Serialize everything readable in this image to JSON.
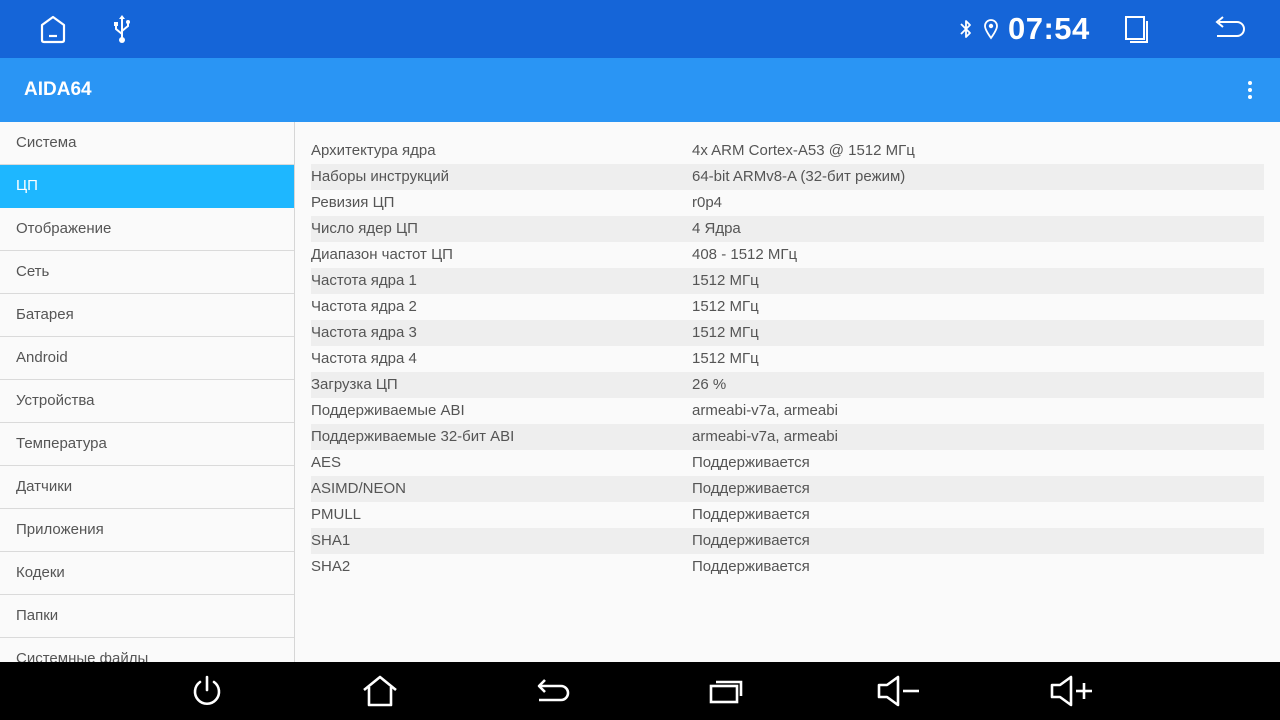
{
  "status_bar": {
    "time": "07:54",
    "icons": [
      "home-icon",
      "usb-icon",
      "bluetooth-icon",
      "location-icon",
      "window-icon",
      "back-icon"
    ]
  },
  "app_bar": {
    "title": "AIDA64",
    "menu_icon": "more-vert-icon"
  },
  "sidebar": {
    "items": [
      {
        "label": "Система",
        "active": false
      },
      {
        "label": "ЦП",
        "active": true
      },
      {
        "label": "Отображение",
        "active": false
      },
      {
        "label": "Сеть",
        "active": false
      },
      {
        "label": "Батарея",
        "active": false
      },
      {
        "label": "Android",
        "active": false
      },
      {
        "label": "Устройства",
        "active": false
      },
      {
        "label": "Температура",
        "active": false
      },
      {
        "label": "Датчики",
        "active": false
      },
      {
        "label": "Приложения",
        "active": false
      },
      {
        "label": "Кодеки",
        "active": false
      },
      {
        "label": "Папки",
        "active": false
      },
      {
        "label": "Системные файлы",
        "active": false
      }
    ]
  },
  "details": {
    "rows": [
      {
        "key": "Архитектура ядра",
        "value": "4x ARM Cortex-A53 @ 1512 МГц"
      },
      {
        "key": "Наборы инструкций",
        "value": "64-bit ARMv8-A (32-бит режим)"
      },
      {
        "key": "Ревизия ЦП",
        "value": "r0p4"
      },
      {
        "key": "Число ядер ЦП",
        "value": "4 Ядра"
      },
      {
        "key": "Диапазон частот ЦП",
        "value": "408 - 1512 МГц"
      },
      {
        "key": "Частота ядра 1",
        "value": "1512 МГц"
      },
      {
        "key": "Частота ядра 2",
        "value": "1512 МГц"
      },
      {
        "key": "Частота ядра 3",
        "value": "1512 МГц"
      },
      {
        "key": "Частота ядра 4",
        "value": "1512 МГц"
      },
      {
        "key": "Загрузка ЦП",
        "value": "26 %"
      },
      {
        "key": "Поддерживаемые ABI",
        "value": "armeabi-v7a, armeabi"
      },
      {
        "key": "Поддерживаемые 32-бит ABI",
        "value": "armeabi-v7a, armeabi"
      },
      {
        "key": "AES",
        "value": "Поддерживается"
      },
      {
        "key": "ASIMD/NEON",
        "value": "Поддерживается"
      },
      {
        "key": "PMULL",
        "value": "Поддерживается"
      },
      {
        "key": "SHA1",
        "value": "Поддерживается"
      },
      {
        "key": "SHA2",
        "value": "Поддерживается"
      }
    ]
  },
  "nav_bar": {
    "buttons": [
      "power-icon",
      "home-icon",
      "back-icon",
      "recents-icon",
      "volume-down-icon",
      "volume-up-icon"
    ]
  },
  "colors": {
    "status_bar": "#1565d8",
    "app_bar": "#2a95f4",
    "active_item": "#1eb7ff",
    "nav_bar": "#000000"
  }
}
